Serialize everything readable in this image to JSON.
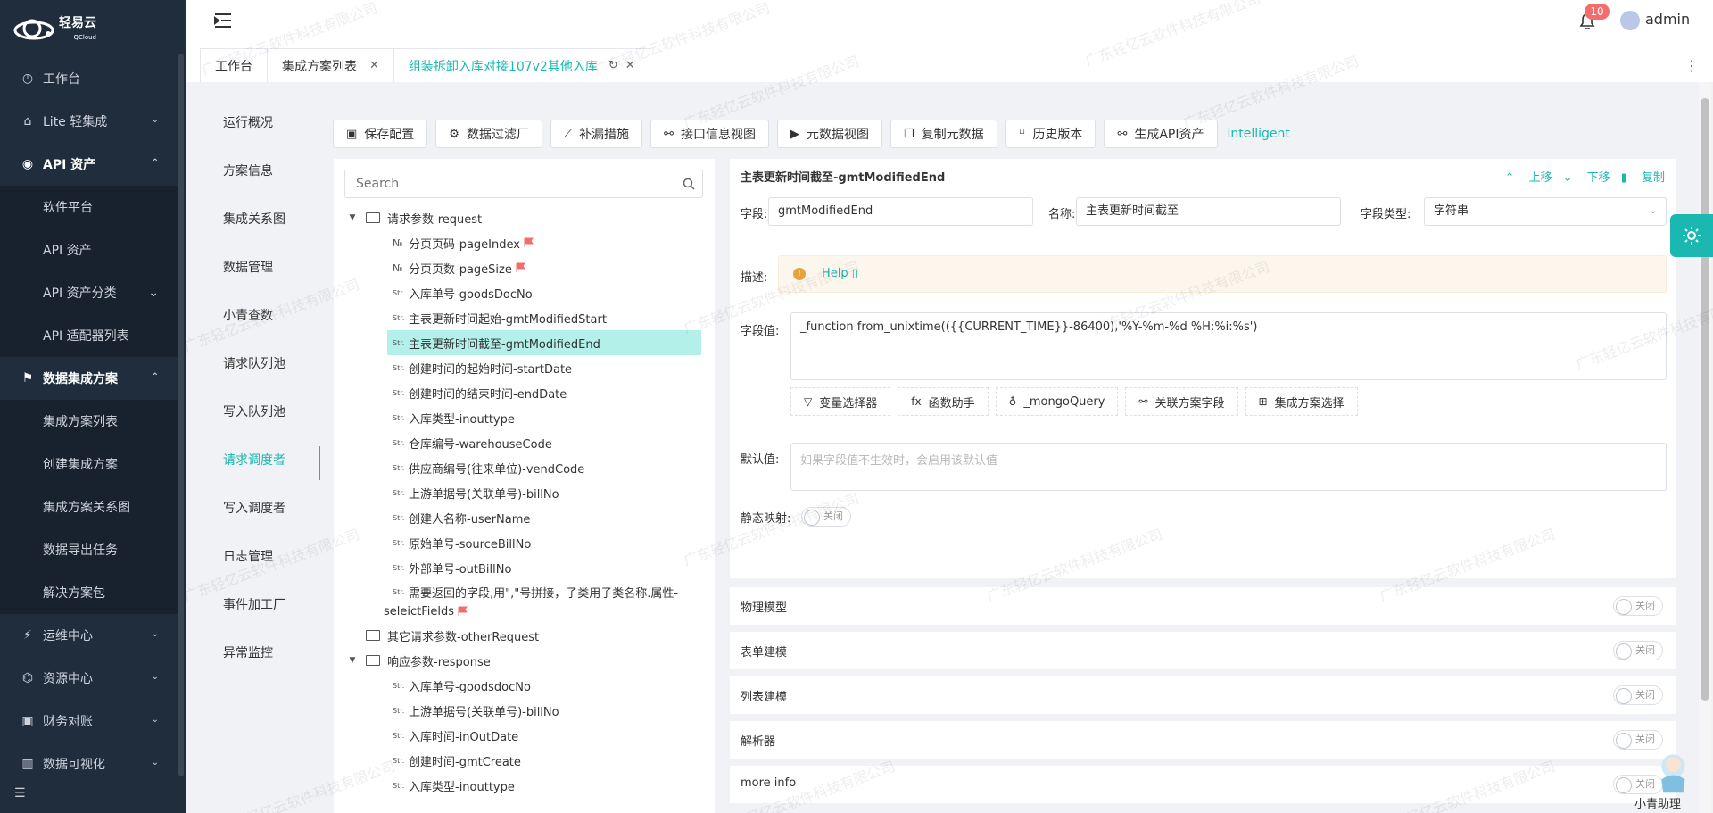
{
  "app": {
    "logo_text": "轻易云",
    "logo_sub": "QCloud"
  },
  "sidebar": {
    "items": [
      {
        "label": "工作台",
        "icon": "clock-icon",
        "type": "item"
      },
      {
        "label": "Lite 轻集成",
        "icon": "lite-icon",
        "type": "item",
        "arrow": "⌄"
      },
      {
        "label": "API 资产",
        "icon": "compass-icon",
        "type": "open",
        "arrow": "⌃"
      },
      {
        "label": "软件平台",
        "type": "sub"
      },
      {
        "label": "API 资产",
        "type": "sub"
      },
      {
        "label": "API 资产分类",
        "type": "sub",
        "arrow": "⌄"
      },
      {
        "label": "API 适配器列表",
        "type": "sub"
      },
      {
        "label": "数据集成方案",
        "icon": "integration-icon",
        "type": "open",
        "arrow": "⌃"
      },
      {
        "label": "集成方案列表",
        "type": "sub"
      },
      {
        "label": "创建集成方案",
        "type": "sub"
      },
      {
        "label": "集成方案关系图",
        "type": "sub"
      },
      {
        "label": "数据导出任务",
        "type": "sub"
      },
      {
        "label": "解决方案包",
        "type": "sub"
      },
      {
        "label": "运维中心",
        "icon": "ops-icon",
        "type": "item",
        "arrow": "⌄"
      },
      {
        "label": "资源中心",
        "icon": "resource-icon",
        "type": "item",
        "arrow": "⌄"
      },
      {
        "label": "财务对账",
        "icon": "finance-icon",
        "type": "item",
        "arrow": "⌄"
      },
      {
        "label": "数据可视化",
        "icon": "chart-icon",
        "type": "item",
        "arrow": "⌄"
      }
    ]
  },
  "header": {
    "notification_count": "10",
    "user": "admin",
    "tabs": [
      {
        "label": "工作台",
        "closable": false
      },
      {
        "label": "集成方案列表",
        "closable": true
      },
      {
        "label": "组装拆卸入库对接107v2其他入库",
        "closable": true,
        "active": true
      }
    ]
  },
  "left_nav": {
    "items": [
      "运行概况",
      "方案信息",
      "集成关系图",
      "数据管理",
      "小青查数",
      "请求队列池",
      "写入队列池",
      "请求调度者",
      "写入调度者",
      "日志管理",
      "事件加工厂",
      "异常监控"
    ],
    "active_index": 7
  },
  "toolbar": {
    "buttons": [
      {
        "label": "保存配置",
        "icon": "save-icon"
      },
      {
        "label": "数据过滤厂",
        "icon": "gear-icon"
      },
      {
        "label": "补漏措施",
        "icon": "chart-line-icon"
      },
      {
        "label": "接口信息视图",
        "icon": "link-icon"
      },
      {
        "label": "元数据视图",
        "icon": "terminal-icon"
      },
      {
        "label": "复制元数据",
        "icon": "copy-icon"
      },
      {
        "label": "历史版本",
        "icon": "branch-icon"
      },
      {
        "label": "生成API资产",
        "icon": "link-icon"
      }
    ],
    "link": "intelligent"
  },
  "tree": {
    "search_placeholder": "Search",
    "nodes": [
      {
        "type": "folder",
        "expanded": true,
        "indent": 0,
        "label": "请求参数-request"
      },
      {
        "type": "no",
        "indent": 1,
        "label": "分页页码-pageIndex",
        "flag": true
      },
      {
        "type": "no",
        "indent": 1,
        "label": "分页页数-pageSize",
        "flag": true
      },
      {
        "type": "str",
        "indent": 1,
        "label": "入库单号-goodsDocNo"
      },
      {
        "type": "str",
        "indent": 1,
        "label": "主表更新时间起始-gmtModifiedStart"
      },
      {
        "type": "str",
        "indent": 1,
        "label": "主表更新时间截至-gmtModifiedEnd",
        "selected": true
      },
      {
        "type": "str",
        "indent": 1,
        "label": "创建时间的起始时间-startDate"
      },
      {
        "type": "str",
        "indent": 1,
        "label": "创建时间的结束时间-endDate"
      },
      {
        "type": "str",
        "indent": 1,
        "label": "入库类型-inouttype"
      },
      {
        "type": "str",
        "indent": 1,
        "label": "仓库编号-warehouseCode"
      },
      {
        "type": "str",
        "indent": 1,
        "label": "供应商编号(往来单位)-vendCode"
      },
      {
        "type": "str",
        "indent": 1,
        "label": "上游单据号(关联单号)-billNo"
      },
      {
        "type": "str",
        "indent": 1,
        "label": "创建人名称-userName"
      },
      {
        "type": "str",
        "indent": 1,
        "label": "原始单号-sourceBillNo"
      },
      {
        "type": "str",
        "indent": 1,
        "label": "外部单号-outBillNo"
      },
      {
        "type": "str-wrap",
        "indent": 1,
        "label": "需要返回的字段,用\",\"号拼接，子类用子类名称.属性-",
        "label2": "seleictFields",
        "flag": true
      },
      {
        "type": "folder",
        "expanded": false,
        "indent": 0,
        "label": "其它请求参数-otherRequest"
      },
      {
        "type": "folder",
        "expanded": true,
        "indent": 0,
        "label": "响应参数-response"
      },
      {
        "type": "str",
        "indent": 1,
        "label": "入库单号-goodsdocNo"
      },
      {
        "type": "str",
        "indent": 1,
        "label": "上游单据号(关联单号)-billNo"
      },
      {
        "type": "str",
        "indent": 1,
        "label": "入库时间-inOutDate"
      },
      {
        "type": "str",
        "indent": 1,
        "label": "创建时间-gmtCreate"
      },
      {
        "type": "str",
        "indent": 1,
        "label": "入库类型-inouttype"
      }
    ]
  },
  "detail": {
    "title": "主表更新时间截至-gmtModifiedEnd",
    "actions": [
      "上移",
      "下移",
      "复制"
    ],
    "field_label": "字段:",
    "field_value": "gmtModifiedEnd",
    "name_label": "名称:",
    "name_value": "主表更新时间截至",
    "type_label": "字段类型:",
    "type_value": "字符串",
    "desc_label": "描述:",
    "help": "Help",
    "value_label": "字段值:",
    "value": "_function from_unixtime(({{CURRENT_TIME}}-86400),'%Y-%m-%d %H:%i:%s')",
    "func_buttons": [
      {
        "label": "变量选择器",
        "icon": "filter-icon"
      },
      {
        "label": "函数助手",
        "icon": "fx-icon"
      },
      {
        "label": "_mongoQuery",
        "icon": "bulb-icon"
      },
      {
        "label": "关联方案字段",
        "icon": "link-icon"
      },
      {
        "label": "集成方案选择",
        "icon": "cube-icon"
      }
    ],
    "default_label": "默认值:",
    "default_placeholder": "如果字段值不生效时，会启用该默认值",
    "static_label": "静态映射:",
    "switch_off": "关闭"
  },
  "sections": [
    {
      "label": "物理模型"
    },
    {
      "label": "表单建模"
    },
    {
      "label": "列表建模"
    },
    {
      "label": "解析器"
    },
    {
      "label": "more info"
    }
  ],
  "assistant_label": "小青助理",
  "watermark": "广东轻亿云软件科技有限公司"
}
